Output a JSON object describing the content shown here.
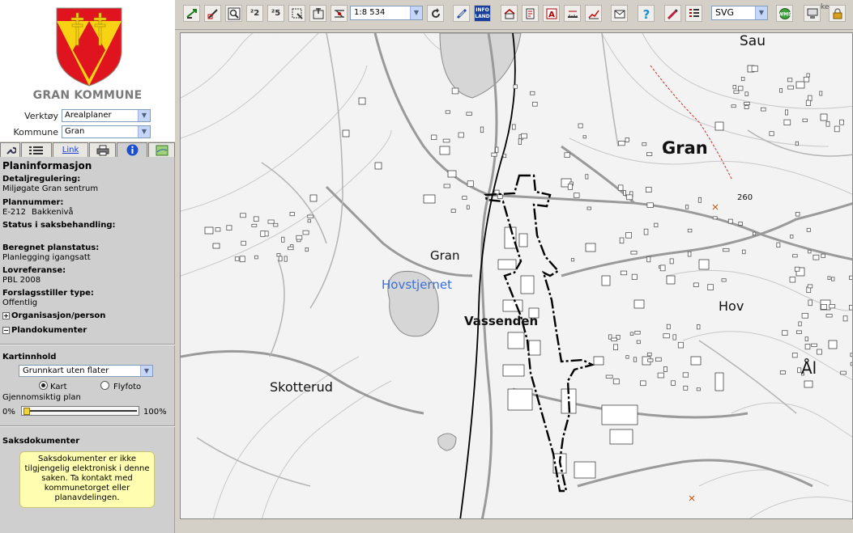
{
  "brand": {
    "name": "GRAN KOMMUNE"
  },
  "selectors": {
    "verktoy_label": "Verktøy",
    "verktoy_value": "Arealplaner",
    "kommune_label": "Kommune",
    "kommune_value": "Gran"
  },
  "tabs": {
    "link_label": "Link"
  },
  "plan": {
    "title": "Planinformasjon",
    "detaljregulering_label": "Detaljregulering:",
    "detaljregulering_value": "Miljøgate Gran sentrum",
    "plannummer_label": "Plannummer:",
    "plannummer_id": "E-212",
    "plannummer_name": "Bakkenivå",
    "status_label": "Status i saksbehandling:",
    "beregnet_label": "Beregnet planstatus:",
    "beregnet_value": "Planlegging igangsatt",
    "lovreferanse_label": "Lovreferanse:",
    "lovreferanse_value": "PBL 2008",
    "forslagsstiller_label": "Forslagsstiller type:",
    "forslagsstiller_value": "Offentlig",
    "org_label": "Organisasjon/person",
    "plandok_label": "Plandokumenter"
  },
  "kartinnhold": {
    "title": "Kartinnhold",
    "select_value": "Grunnkart uten flater",
    "radio_kart": "Kart",
    "radio_flyfoto": "Flyfoto",
    "radio_selected": "Kart",
    "gjennomsiktig_label": "Gjennomsiktig plan",
    "min_label": "0%",
    "max_label": "100%",
    "transparency_percent": 0
  },
  "saksdokumenter": {
    "title": "Saksdokumenter",
    "notice": "Saksdokumenter er ikke tilgjengelig elektronisk i denne saken. Ta kontakt med kommunetorget eller planavdelingen."
  },
  "toolbar": {
    "zoom2_label": "²2",
    "zoom5_label": "²5",
    "scale_value": "1:8 534",
    "info_label": "INFO LAND",
    "format_value": "SVG",
    "corner_text": "ke"
  },
  "map": {
    "places": {
      "sau": "Sau",
      "gran_big": "Gran",
      "road_number": "260",
      "gran_small": "Gran",
      "hovstjernet": "Hovstjernet",
      "vassenden": "Vassenden",
      "hov": "Hov",
      "al": "Ål",
      "skotterud": "Skotterud"
    },
    "colors": {
      "water_label": "#3a6fd8",
      "boundary": "#000000",
      "trail": "#cc3333"
    }
  }
}
